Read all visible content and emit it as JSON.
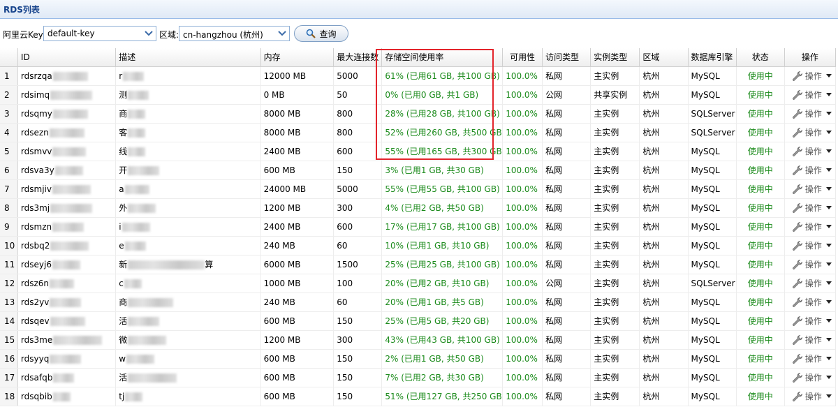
{
  "panel": {
    "title": "RDS列表"
  },
  "toolbar": {
    "key_label": "阿里云Key:",
    "key_value": "default-key",
    "region_label": "区域:",
    "region_value": "cn-hangzhou (杭州)",
    "search_label": "查询"
  },
  "columns": {
    "id": "ID",
    "desc": "描述",
    "memory": "内存",
    "max_conn": "最大连接数",
    "storage": "存储空间使用率",
    "availability": "可用性",
    "access": "访问类型",
    "instance_type": "实例类型",
    "region": "区域",
    "engine": "数据库引擎",
    "status": "状态",
    "ops": "操作"
  },
  "rows": [
    {
      "n": "1",
      "id": "rdsrzqa",
      "desc": "r",
      "mem": "12000 MB",
      "conn": "5000",
      "storage": "61% (已用61 GB, 共100 GB)",
      "avail": "100.0%",
      "access": "私网",
      "itype": "主实例",
      "region": "杭州",
      "engine": "MySQL",
      "status": "使用中",
      "op": "操作"
    },
    {
      "n": "2",
      "id": "rdsimq",
      "desc": "测",
      "mem": "0 MB",
      "conn": "50",
      "storage": "0% (已用0 GB, 共1 GB)",
      "avail": "100.0%",
      "access": "公网",
      "itype": "共享实例",
      "region": "杭州",
      "engine": "MySQL",
      "status": "使用中",
      "op": "操作"
    },
    {
      "n": "3",
      "id": "rdsqmy",
      "desc": "商",
      "mem": "8000 MB",
      "conn": "800",
      "storage": "28% (已用28 GB, 共100 GB)",
      "avail": "100.0%",
      "access": "私网",
      "itype": "主实例",
      "region": "杭州",
      "engine": "SQLServer",
      "status": "使用中",
      "op": "操作"
    },
    {
      "n": "4",
      "id": "rdsezn",
      "desc": "客",
      "mem": "8000 MB",
      "conn": "800",
      "storage": "52% (已用260 GB, 共500 GB)",
      "avail": "100.0%",
      "access": "私网",
      "itype": "主实例",
      "region": "杭州",
      "engine": "SQLServer",
      "status": "使用中",
      "op": "操作"
    },
    {
      "n": "5",
      "id": "rdsmvv",
      "desc": "线",
      "mem": "2400 MB",
      "conn": "600",
      "storage": "55% (已用165 GB, 共300 GB)",
      "avail": "100.0%",
      "access": "私网",
      "itype": "主实例",
      "region": "杭州",
      "engine": "MySQL",
      "status": "使用中",
      "op": "操作"
    },
    {
      "n": "6",
      "id": "rdsva3y",
      "desc": "开",
      "mem": "600 MB",
      "conn": "150",
      "storage": "3% (已用1 GB, 共30 GB)",
      "avail": "100.0%",
      "access": "私网",
      "itype": "主实例",
      "region": "杭州",
      "engine": "MySQL",
      "status": "使用中",
      "op": "操作"
    },
    {
      "n": "7",
      "id": "rdsmjiv",
      "desc": "a",
      "mem": "24000 MB",
      "conn": "5000",
      "storage": "55% (已用55 GB, 共100 GB)",
      "avail": "100.0%",
      "access": "私网",
      "itype": "主实例",
      "region": "杭州",
      "engine": "MySQL",
      "status": "使用中",
      "op": "操作"
    },
    {
      "n": "8",
      "id": "rds3mj",
      "desc": "外",
      "mem": "1200 MB",
      "conn": "300",
      "storage": "4% (已用2 GB, 共50 GB)",
      "avail": "100.0%",
      "access": "私网",
      "itype": "主实例",
      "region": "杭州",
      "engine": "MySQL",
      "status": "使用中",
      "op": "操作"
    },
    {
      "n": "9",
      "id": "rdsmzn",
      "desc": "i",
      "mem": "2400 MB",
      "conn": "600",
      "storage": "17% (已用17 GB, 共100 GB)",
      "avail": "100.0%",
      "access": "私网",
      "itype": "主实例",
      "region": "杭州",
      "engine": "MySQL",
      "status": "使用中",
      "op": "操作"
    },
    {
      "n": "10",
      "id": "rdsbq2",
      "desc": "e",
      "mem": "240 MB",
      "conn": "60",
      "storage": "10% (已用1 GB, 共10 GB)",
      "avail": "100.0%",
      "access": "私网",
      "itype": "主实例",
      "region": "杭州",
      "engine": "MySQL",
      "status": "使用中",
      "op": "操作"
    },
    {
      "n": "11",
      "id": "rdseyj6",
      "desc": "新",
      "desc_tail": "算",
      "mem": "6000 MB",
      "conn": "1500",
      "storage": "25% (已用25 GB, 共100 GB)",
      "avail": "100.0%",
      "access": "私网",
      "itype": "主实例",
      "region": "杭州",
      "engine": "MySQL",
      "status": "使用中",
      "op": "操作"
    },
    {
      "n": "12",
      "id": "rdsz6n",
      "desc": "c",
      "mem": "1000 MB",
      "conn": "100",
      "storage": "20% (已用2 GB, 共10 GB)",
      "avail": "100.0%",
      "access": "公网",
      "itype": "主实例",
      "region": "杭州",
      "engine": "SQLServer",
      "status": "使用中",
      "op": "操作"
    },
    {
      "n": "13",
      "id": "rds2yv",
      "desc": "商",
      "mem": "240 MB",
      "conn": "60",
      "storage": "20% (已用1 GB, 共5 GB)",
      "avail": "100.0%",
      "access": "私网",
      "itype": "主实例",
      "region": "杭州",
      "engine": "MySQL",
      "status": "使用中",
      "op": "操作"
    },
    {
      "n": "14",
      "id": "rdsqev",
      "desc": "活",
      "mem": "600 MB",
      "conn": "150",
      "storage": "25% (已用5 GB, 共20 GB)",
      "avail": "100.0%",
      "access": "私网",
      "itype": "主实例",
      "region": "杭州",
      "engine": "MySQL",
      "status": "使用中",
      "op": "操作"
    },
    {
      "n": "15",
      "id": "rds3me",
      "desc": "微",
      "mem": "1200 MB",
      "conn": "300",
      "storage": "43% (已用43 GB, 共100 GB)",
      "avail": "100.0%",
      "access": "私网",
      "itype": "主实例",
      "region": "杭州",
      "engine": "MySQL",
      "status": "使用中",
      "op": "操作"
    },
    {
      "n": "16",
      "id": "rdsyyq",
      "desc": "w",
      "mem": "600 MB",
      "conn": "150",
      "storage": "2% (已用1 GB, 共50 GB)",
      "avail": "100.0%",
      "access": "私网",
      "itype": "主实例",
      "region": "杭州",
      "engine": "MySQL",
      "status": "使用中",
      "op": "操作"
    },
    {
      "n": "17",
      "id": "rdsafqb",
      "desc": "活",
      "mem": "600 MB",
      "conn": "150",
      "storage": "7% (已用2 GB, 共30 GB)",
      "avail": "100.0%",
      "access": "私网",
      "itype": "主实例",
      "region": "杭州",
      "engine": "MySQL",
      "status": "使用中",
      "op": "操作"
    },
    {
      "n": "18",
      "id": "rdsqbib",
      "desc": "tj",
      "mem": "600 MB",
      "conn": "150",
      "storage": "51% (已用127 GB, 共250 GB)",
      "avail": "100.0%",
      "access": "私网",
      "itype": "主实例",
      "region": "杭州",
      "engine": "MySQL",
      "status": "使用中",
      "op": "操作"
    }
  ],
  "colors": {
    "green": "#1a8a1a",
    "highlight": "#e3242b",
    "header_text": "#15428b"
  },
  "icons": {
    "op": "wrench-icon",
    "dropdown": "chevron-down-icon",
    "search": "magnifier-icon"
  }
}
